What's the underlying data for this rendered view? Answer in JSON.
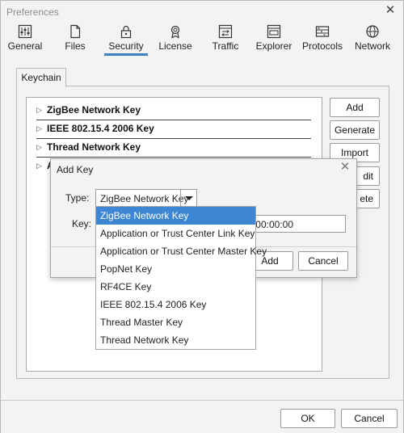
{
  "window": {
    "title": "Preferences"
  },
  "toolbar": {
    "items": [
      {
        "label": "General",
        "icon": "sliders-icon"
      },
      {
        "label": "Files",
        "icon": "file-icon"
      },
      {
        "label": "Security",
        "icon": "lock-icon",
        "active": true
      },
      {
        "label": "License",
        "icon": "award-icon"
      },
      {
        "label": "Traffic",
        "icon": "traffic-icon"
      },
      {
        "label": "Explorer",
        "icon": "folder-icon"
      },
      {
        "label": "Protocols",
        "icon": "protocols-icon"
      },
      {
        "label": "Network",
        "icon": "globe-icon"
      }
    ]
  },
  "subtabs": {
    "keychain": "Keychain"
  },
  "keychain": {
    "rows": [
      "ZigBee Network Key",
      "IEEE 802.15.4 2006 Key",
      "Thread Network Key",
      "A"
    ],
    "buttons": {
      "add": "Add",
      "generate": "Generate",
      "import": "Import",
      "edit": "dit",
      "delete": "ete"
    }
  },
  "add_key_dialog": {
    "title": "Add Key",
    "type_label": "Type:",
    "type_value": "ZigBee Network Key",
    "key_label": "Key:",
    "key_value": ":00:00:00",
    "add": "Add",
    "cancel": "Cancel",
    "options": [
      "ZigBee Network Key",
      "Application or Trust Center Link Key",
      "Application or Trust Center Master Key",
      "PopNet Key",
      "RF4CE Key",
      "IEEE 802.15.4 2006 Key",
      "Thread Master Key",
      "Thread Network Key"
    ],
    "selected_index": 0
  },
  "footer": {
    "ok": "OK",
    "cancel": "Cancel"
  },
  "colors": {
    "accent": "#3d86d4",
    "background": "#f3f3f3"
  }
}
